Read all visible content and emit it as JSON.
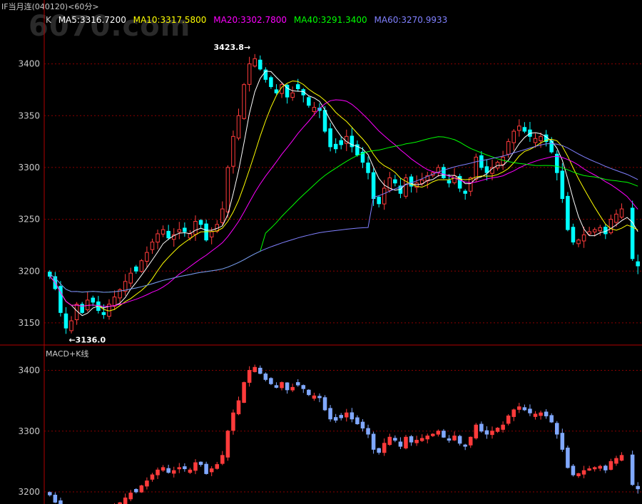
{
  "header": {
    "title": "IF当月连(040120)<60分>",
    "watermark": "6070.com"
  },
  "ma_legend": {
    "k_label": "K",
    "items": [
      {
        "label": "MA5:3316.7200",
        "color": "#ffffff"
      },
      {
        "label": "MA10:3317.5800",
        "color": "#ffff00"
      },
      {
        "label": "MA20:3302.7800",
        "color": "#ff00ff"
      },
      {
        "label": "MA40:3291.3400",
        "color": "#00ff00"
      },
      {
        "label": "MA60:3270.9933",
        "color": "#8080ff"
      }
    ]
  },
  "sub_panel": {
    "label": "MACD+K线"
  },
  "colors": {
    "up": "#ff3b3b",
    "down": "#00ffff",
    "sub_up": "#ff3b3b",
    "sub_down": "#80a8ff",
    "grid": "#8b0000",
    "frame": "#b00000"
  },
  "chart_data": [
    {
      "type": "candlestick",
      "panel": "main",
      "y_ticks": [
        3150,
        3200,
        3250,
        3300,
        3350,
        3400
      ],
      "ylim": [
        3130,
        3430
      ],
      "annotations": [
        {
          "label": "3423.8",
          "kind": "high"
        },
        {
          "label": "3136.0",
          "kind": "low"
        }
      ],
      "close": [
        3195,
        3183,
        3160,
        3145,
        3152,
        3168,
        3160,
        3172,
        3170,
        3162,
        3158,
        3168,
        3175,
        3182,
        3190,
        3198,
        3200,
        3210,
        3218,
        3228,
        3236,
        3240,
        3232,
        3235,
        3240,
        3238,
        3236,
        3248,
        3245,
        3230,
        3238,
        3245,
        3260,
        3300,
        3330,
        3350,
        3380,
        3400,
        3405,
        3395,
        3385,
        3378,
        3372,
        3380,
        3368,
        3372,
        3376,
        3370,
        3360,
        3358,
        3355,
        3335,
        3320,
        3318,
        3322,
        3330,
        3320,
        3312,
        3305,
        3295,
        3270,
        3265,
        3280,
        3290,
        3285,
        3275,
        3290,
        3282,
        3285,
        3288,
        3292,
        3295,
        3300,
        3290,
        3285,
        3292,
        3280,
        3275,
        3290,
        3310,
        3300,
        3295,
        3300,
        3305,
        3310,
        3325,
        3335,
        3340,
        3335,
        3330,
        3328,
        3330,
        3325,
        3315,
        3295,
        3270,
        3240,
        3228,
        3230,
        3235,
        3238,
        3240,
        3242,
        3236,
        3250,
        3255,
        3260,
        3258,
        3212,
        3205
      ],
      "volatility_hint": "ohlc approximated from picture"
    },
    {
      "type": "candlestick",
      "panel": "sub",
      "y_ticks": [
        3200,
        3300,
        3400
      ],
      "ylim": [
        3180,
        3430
      ]
    }
  ]
}
